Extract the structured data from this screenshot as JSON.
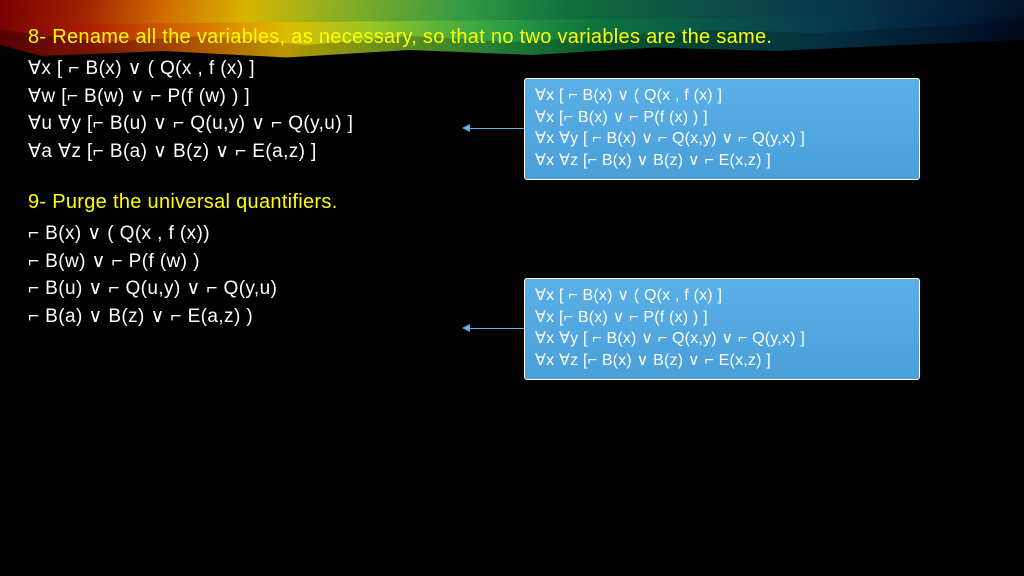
{
  "section8": {
    "heading": "8- Rename all the variables, as necessary, so that no two variables are the same.",
    "lines": [
      "∀x   [ ⌐  B(x) ∨ (  Q(x , f (x) ]",
      "∀w [⌐  B(w) ∨ ⌐  P(f (w) )  ]",
      "∀u  ∀y   [⌐  B(u) ∨ ⌐  Q(u,y) ∨ ⌐  Q(y,u) ]",
      "∀a   ∀z  [⌐  B(a) ∨ B(z)  ∨ ⌐  E(a,z)  ]"
    ]
  },
  "section9": {
    "heading": "9- Purge the universal quantifiers.",
    "lines": [
      "⌐  B(x) ∨ (  Q(x , f (x))",
      "⌐  B(w) ∨ ⌐  P(f (w) )",
      "⌐  B(u) ∨ ⌐  Q(u,y) ∨ ⌐  Q(y,u)",
      "⌐  B(a) ∨ B(z)  ∨ ⌐  E(a,z) )"
    ]
  },
  "callout_top": {
    "lines": [
      "∀x   [ ⌐  B(x) ∨ (  Q(x , f (x) ]",
      "∀x [⌐  B(x) ∨ ⌐  P(f (x) )  ]",
      "∀x  ∀y   [ ⌐  B(x) ∨ ⌐  Q(x,y) ∨ ⌐  Q(y,x) ]",
      " ∀x   ∀z  [⌐  B(x) ∨ B(z)  ∨ ⌐  E(x,z)   ]"
    ]
  },
  "callout_bottom": {
    "lines": [
      "∀x   [ ⌐  B(x) ∨ (  Q(x , f (x) ]",
      "∀x [⌐  B(x) ∨ ⌐  P(f (x) )  ]",
      "∀x  ∀y   [ ⌐  B(x) ∨ ⌐  Q(x,y) ∨ ⌐  Q(y,x) ]",
      " ∀x   ∀z  [⌐  B(x) ∨ B(z)  ∨ ⌐  E(x,z)   ]"
    ]
  }
}
